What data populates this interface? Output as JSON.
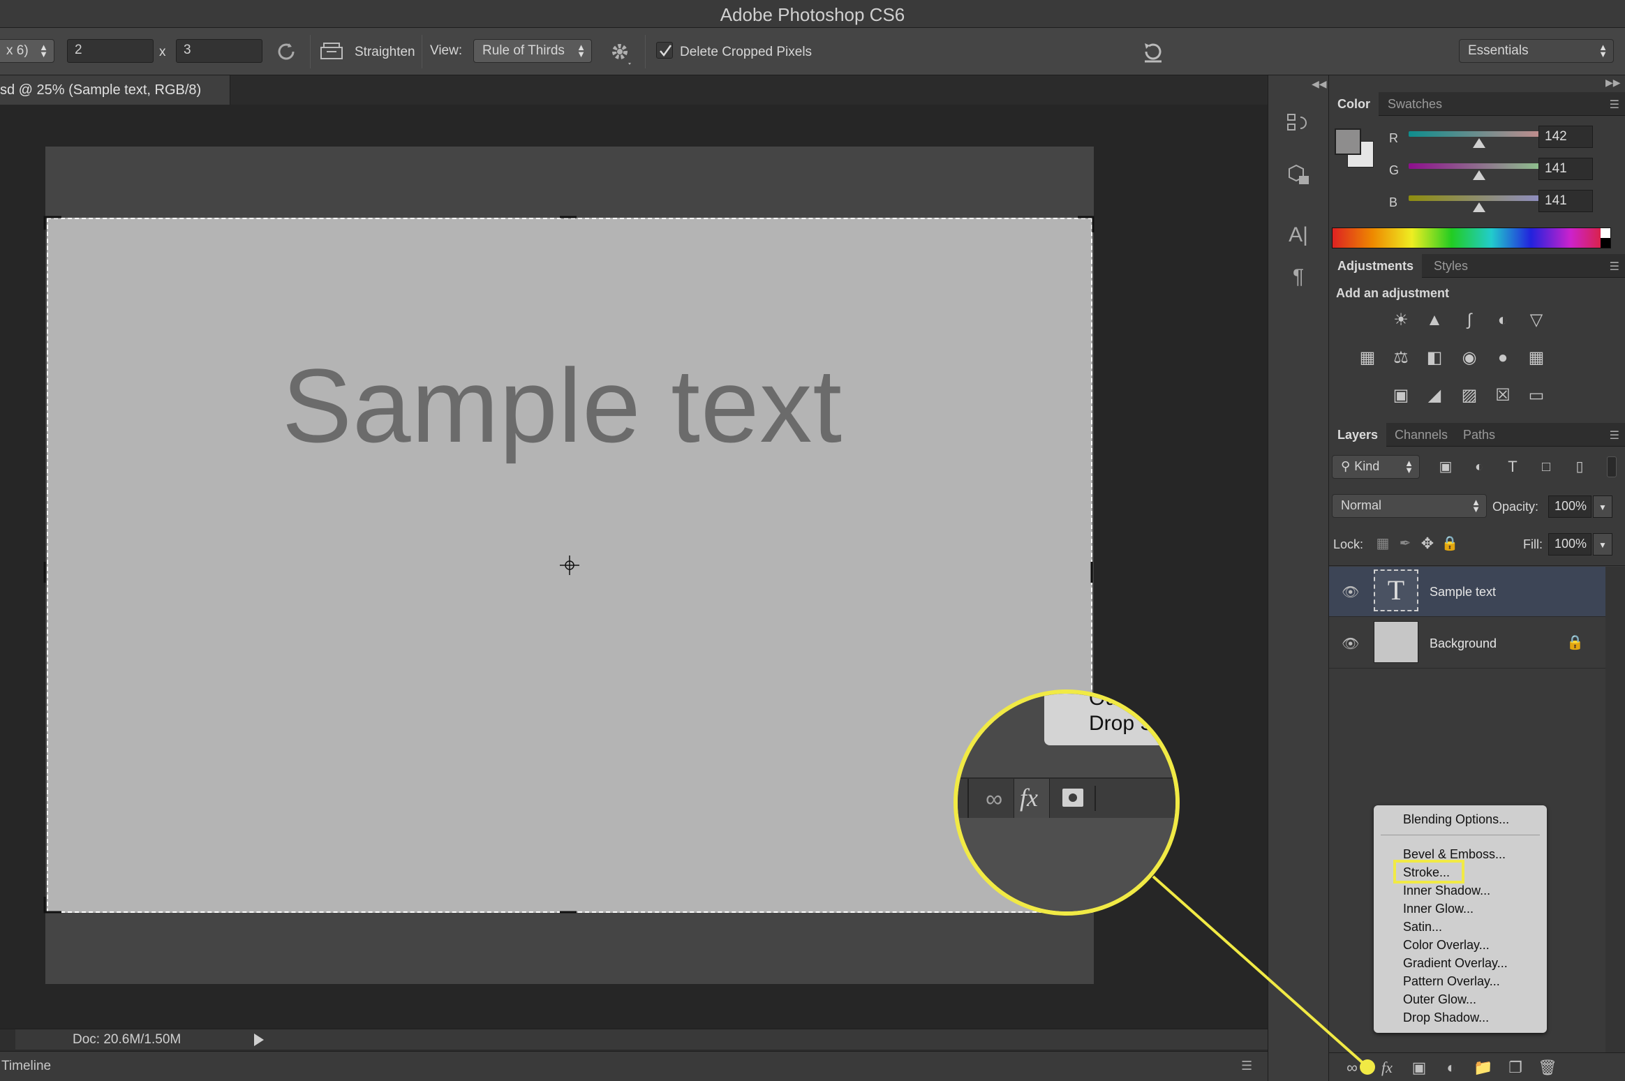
{
  "app": {
    "title": "Adobe Photoshop CS6"
  },
  "options_bar": {
    "ratio_dropdown": "x 6)",
    "width_value": "2",
    "times": "x",
    "height_value": "3",
    "straighten_label": "Straighten",
    "view_label": "View:",
    "view_value": "Rule of Thirds",
    "delete_cropped_label": "Delete Cropped Pixels",
    "delete_cropped_checked": true,
    "workspace_value": "Essentials"
  },
  "document": {
    "tab_label": "sd @ 25% (Sample text, RGB/8)",
    "canvas_text": "Sample text",
    "status_text": "Doc: 20.6M/1.50M"
  },
  "timeline": {
    "label": "Timeline"
  },
  "color_panel": {
    "tabs": [
      "Color",
      "Swatches"
    ],
    "channels": [
      {
        "name": "R",
        "value": "142"
      },
      {
        "name": "G",
        "value": "141"
      },
      {
        "name": "B",
        "value": "141"
      }
    ]
  },
  "adjustments_panel": {
    "tabs": [
      "Adjustments",
      "Styles"
    ],
    "heading": "Add an adjustment"
  },
  "layers_panel": {
    "tabs": [
      "Layers",
      "Channels",
      "Paths"
    ],
    "filter_kind": "Kind",
    "blend_mode": "Normal",
    "opacity_label": "Opacity:",
    "opacity_value": "100%",
    "lock_label": "Lock:",
    "fill_label": "Fill:",
    "fill_value": "100%",
    "layers": [
      {
        "name": "Sample text",
        "type": "text",
        "selected": true
      },
      {
        "name": "Background",
        "type": "pixel",
        "locked": true
      }
    ]
  },
  "fx_menu": {
    "items": [
      "Blending Options...",
      "Bevel & Emboss...",
      "Stroke...",
      "Inner Shadow...",
      "Inner Glow...",
      "Satin...",
      "Color Overlay...",
      "Gradient Overlay...",
      "Pattern Overlay...",
      "Outer Glow...",
      "Drop Shadow..."
    ],
    "highlighted": "Stroke..."
  },
  "zoom_callout": {
    "menu_peek": [
      "Ou",
      "Drop S"
    ],
    "fx_label": "fx"
  },
  "colors": {
    "highlight": "#f1ea45",
    "canvas_gray": "#b4b4b4",
    "text_gray": "#6b6b6b"
  }
}
